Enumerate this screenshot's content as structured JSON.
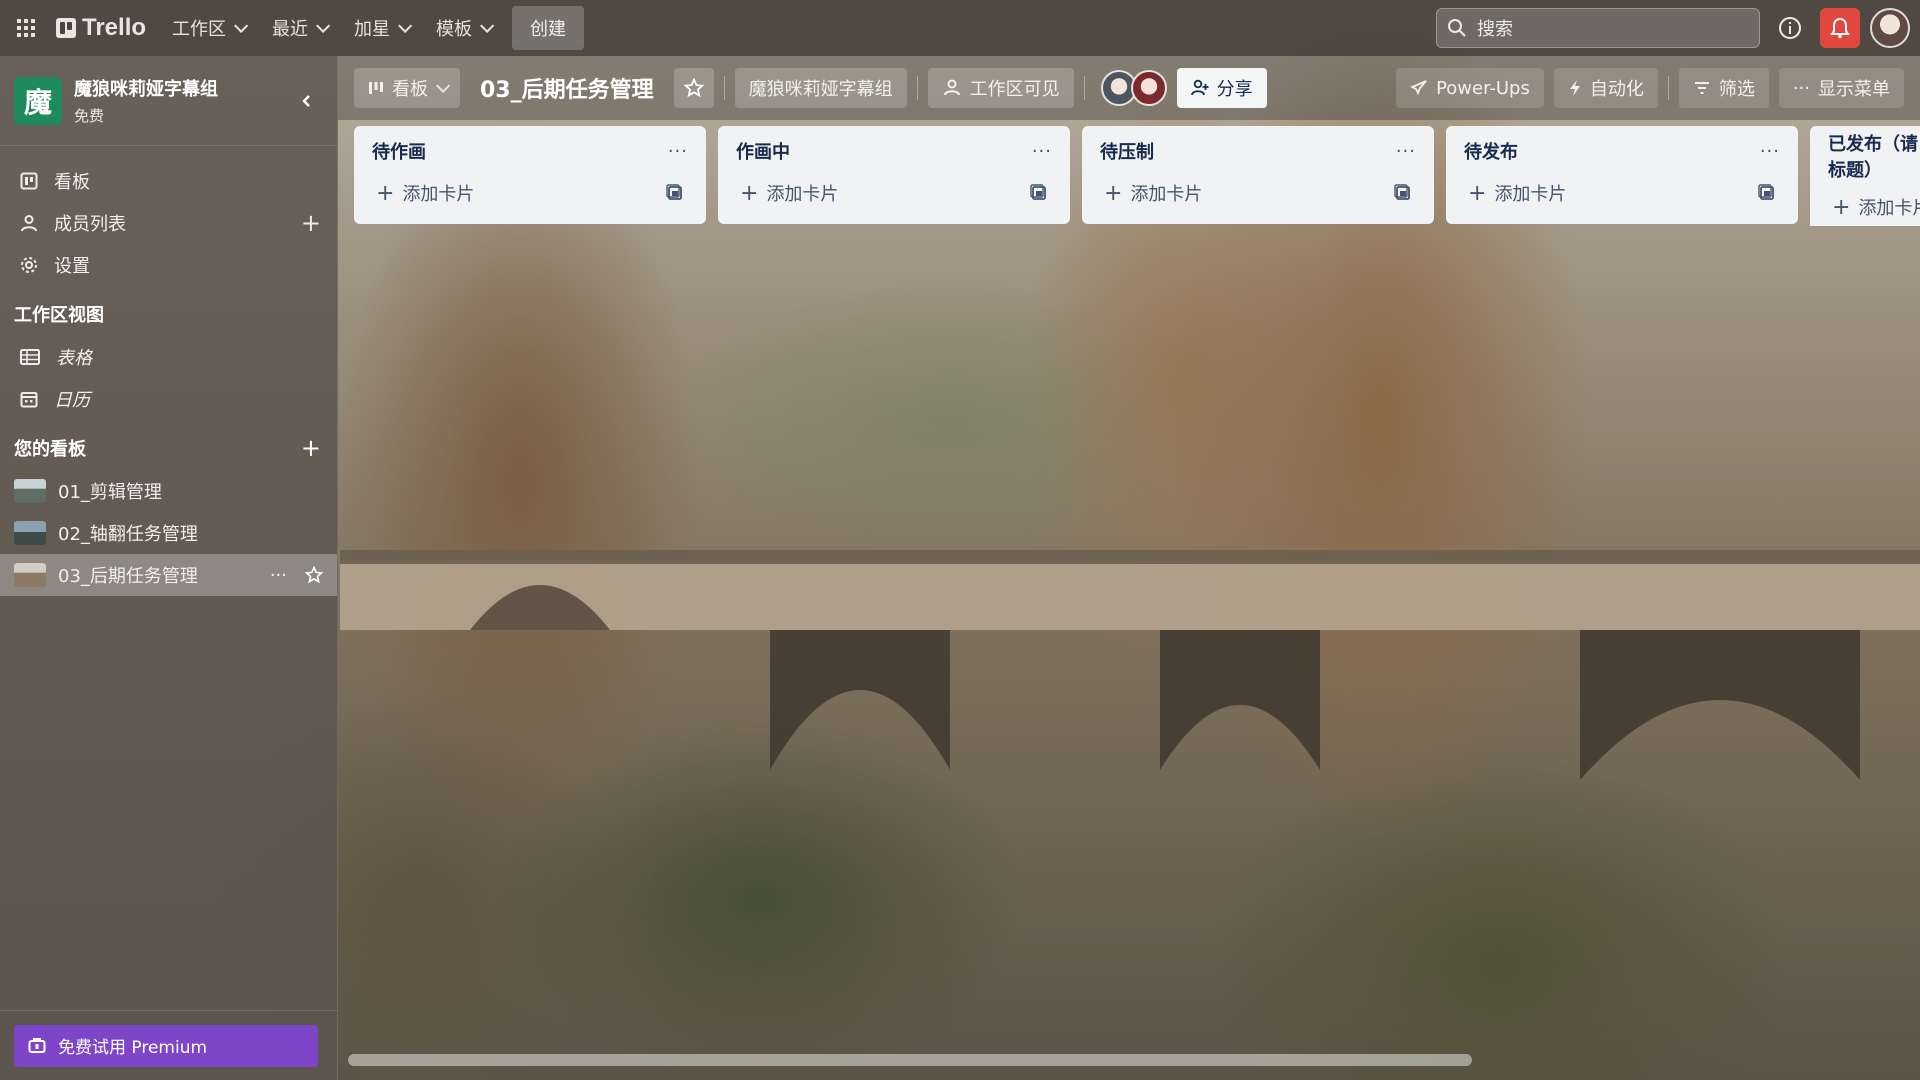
{
  "topbar": {
    "logo": "Trello",
    "menu": [
      {
        "label": "工作区"
      },
      {
        "label": "最近"
      },
      {
        "label": "加星"
      },
      {
        "label": "模板"
      }
    ],
    "create_label": "创建",
    "search_placeholder": "搜索",
    "colors": {
      "notification": "#e2483d"
    }
  },
  "sidebar": {
    "workspace": {
      "initial": "魔",
      "name": "魔狼咪莉娅字幕组",
      "plan": "免费"
    },
    "items": [
      {
        "label": "看板",
        "icon": "board-icon"
      },
      {
        "label": "成员列表",
        "icon": "member-icon"
      },
      {
        "label": "设置",
        "icon": "gear-icon"
      }
    ],
    "views_title": "工作区视图",
    "views": [
      {
        "label": "表格",
        "icon": "table-icon"
      },
      {
        "label": "日历",
        "icon": "calendar-icon"
      }
    ],
    "boards_title": "您的看板",
    "boards": [
      {
        "label": "01_剪辑管理"
      },
      {
        "label": "02_轴翻任务管理"
      },
      {
        "label": "03_后期任务管理"
      }
    ],
    "premium_label": "免费试用 Premium",
    "colors": {
      "premium": "#7d46c9",
      "workspace_avatar": "#1f8a5b"
    }
  },
  "board_header": {
    "view_label": "看板",
    "title": "03_后期任务管理",
    "workspace_label": "魔狼咪莉娅字幕组",
    "visibility_label": "工作区可见",
    "share_label": "分享",
    "powerups_label": "Power-Ups",
    "automation_label": "自动化",
    "filter_label": "筛选",
    "menu_label": "显示菜单"
  },
  "lists": [
    {
      "title": "待作画",
      "add_label": "添加卡片"
    },
    {
      "title": "作画中",
      "add_label": "添加卡片"
    },
    {
      "title": "待压制",
      "add_label": "添加卡片"
    },
    {
      "title": "待发布",
      "add_label": "添加卡片"
    },
    {
      "title": "已发布（请标题）",
      "add_label": "添加卡片"
    }
  ]
}
